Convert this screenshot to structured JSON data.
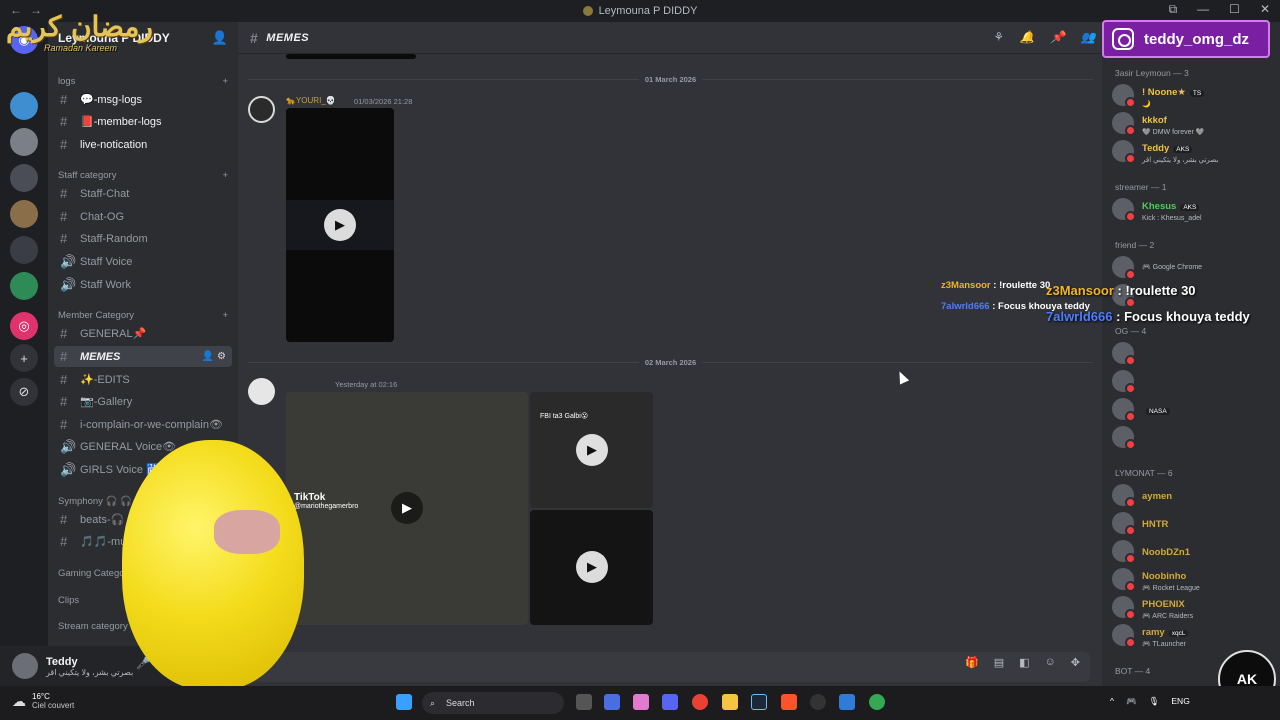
{
  "window": {
    "title": "Leymouna P DIDDY",
    "back_glyph": "←",
    "fwd_glyph": "→",
    "controls": [
      "⧉",
      "—",
      "☐",
      "✕"
    ]
  },
  "server": {
    "name": "Leymouna P DIDDY"
  },
  "sidebar": {
    "logs_category": "logs",
    "channels_top": [
      {
        "label": "💬-msg-logs"
      },
      {
        "label": "📕-member-logs"
      },
      {
        "label": "live-notication"
      }
    ],
    "staff_category": "Staff category",
    "staff_channels": [
      {
        "label": "Staff-Chat"
      },
      {
        "label": "Chat-OG"
      },
      {
        "label": "Staff-Random"
      },
      {
        "label": "Staff Voice"
      },
      {
        "label": "Staff Work"
      }
    ],
    "member_category": "Member Category",
    "member_channels": [
      {
        "label": "GENERAL📌"
      },
      {
        "label": "MEMES"
      },
      {
        "label": "✨-EDITS"
      },
      {
        "label": "📷-Gallery"
      },
      {
        "label": "i-complain-or-we-complain👁"
      },
      {
        "label": "GENERAL Voice👁"
      },
      {
        "label": "GIRLS Voice 🛗"
      }
    ],
    "symphony_category": "Symphony 🎧 🎧",
    "symphony_channels": [
      {
        "label": "beats-🎧"
      },
      {
        "label": "🎵🎵-mu"
      }
    ],
    "other_categories": [
      "Gaming Categor",
      "Clips",
      "Stream category"
    ]
  },
  "user": {
    "name": "Teddy",
    "status": "بصرتي بشر، ولا يتكيني اقر"
  },
  "channel": {
    "name": "MEMES"
  },
  "messages": [
    {
      "date": "01 March 2026",
      "author": "🐆YOURI_💀",
      "time": "01/03/2026 21:28"
    },
    {
      "date": "02 March 2026",
      "author": "",
      "time": "Yesterday at 02:16"
    }
  ],
  "media_text": {
    "tiktok": "TikTok",
    "tiktok_user": "@mariothegamerbro",
    "thumb_caption": "FBI ta3 Galbi😮"
  },
  "overlay_chat": [
    {
      "user": "z3Mansoor",
      "text": "!roulette 30"
    },
    {
      "user": "7alwrld666",
      "text": "Focus khouya teddy"
    }
  ],
  "instagram": {
    "handle": "teddy_omg_dz"
  },
  "members": {
    "groups": [
      {
        "title": "3asir Leymoun — 3",
        "items": [
          {
            "name": "! Noone★",
            "tag": "TS",
            "sub": "🌙",
            "color": "#f0c04a"
          },
          {
            "name": "kkkof",
            "tag": "",
            "sub": "🩶 DMW forever 🩶",
            "color": "#f0c04a"
          },
          {
            "name": "Teddy",
            "tag": "AKS",
            "sub": "بصرتي بشر، ولا يتكيني اقر",
            "color": "#f0c04a"
          }
        ]
      },
      {
        "title": "streamer — 1",
        "items": [
          {
            "name": "Khesus",
            "tag": "AKS",
            "sub": "Kick : Khesus_adel",
            "color": "#57c758"
          }
        ]
      },
      {
        "title": "friend — 2",
        "items": [
          {
            "name": "",
            "tag": "",
            "sub": "🎮 Google Chrome",
            "color": "#b5bac1"
          },
          {
            "name": "",
            "tag": "",
            "sub": "",
            "color": "#b5bac1"
          }
        ]
      },
      {
        "title": "OG — 4",
        "items": [
          {
            "name": "",
            "tag": "",
            "sub": "",
            "color": "#3b4fd0"
          },
          {
            "name": "",
            "tag": "",
            "sub": "",
            "color": "#3b4fd0"
          },
          {
            "name": "",
            "tag": "NASA",
            "sub": "",
            "color": "#3b4fd0"
          },
          {
            "name": "",
            "tag": "",
            "sub": "",
            "color": "#3b4fd0"
          }
        ]
      },
      {
        "title": "LYMONAT — 6",
        "items": [
          {
            "name": "aymen",
            "tag": "",
            "sub": "",
            "color": "#d4a93c"
          },
          {
            "name": "HNTR",
            "tag": "",
            "sub": "",
            "color": "#d4a93c"
          },
          {
            "name": "NoobDZn1",
            "tag": "",
            "sub": "",
            "color": "#d4a93c"
          },
          {
            "name": "Noobinho",
            "tag": "",
            "sub": "🎮 Rocket League",
            "color": "#d4a93c"
          },
          {
            "name": "PHOENIX",
            "tag": "",
            "sub": "🎮 ARC Raiders",
            "color": "#d4a93c"
          },
          {
            "name": "ramy",
            "tag": "xqcL",
            "sub": "🎮 TLauncher",
            "color": "#d4a93c"
          }
        ]
      },
      {
        "title": "BOT — 4",
        "items": []
      }
    ]
  },
  "decor": {
    "ramadan_arabic": "رمضان كريم",
    "ramadan_latin": "Ramadan Kareem",
    "ak_logo": "AK"
  },
  "taskbar": {
    "temp": "16°C",
    "weather": "Ciel couvert",
    "search_placeholder": "Search",
    "lang": "ENG"
  }
}
